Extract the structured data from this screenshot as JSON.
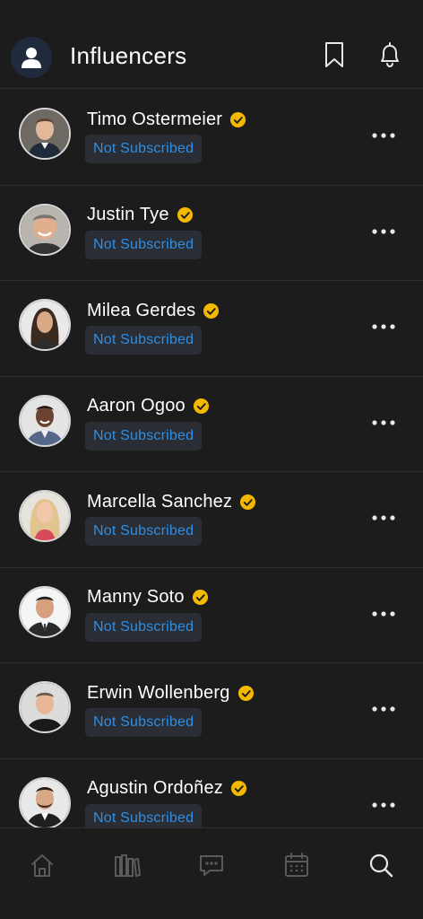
{
  "header": {
    "title": "Influencers",
    "icons": [
      "user-icon",
      "bookmark-icon",
      "bell-icon"
    ]
  },
  "influencers": [
    {
      "name": "Timo Ostermeier",
      "status": "Not Subscribed",
      "verified": true
    },
    {
      "name": "Justin Tye",
      "status": "Not Subscribed",
      "verified": true
    },
    {
      "name": "Milea Gerdes",
      "status": "Not Subscribed",
      "verified": true
    },
    {
      "name": "Aaron Ogoo",
      "status": "Not Subscribed",
      "verified": true
    },
    {
      "name": "Marcella Sanchez",
      "status": "Not Subscribed",
      "verified": true
    },
    {
      "name": "Manny Soto",
      "status": "Not Subscribed",
      "verified": true
    },
    {
      "name": "Erwin Wollenberg",
      "status": "Not Subscribed",
      "verified": true
    },
    {
      "name": "Agustin Ordoñez",
      "status": "Not Subscribed",
      "verified": true
    }
  ],
  "tabbar": {
    "tabs": [
      "home-icon",
      "library-icon",
      "chat-icon",
      "calendar-icon",
      "search-icon"
    ],
    "active": "search-icon"
  },
  "colors": {
    "background": "#1c1c1c",
    "status_text": "#2e8fe6",
    "status_bg": "#2a2d33",
    "verified": "#f3b800",
    "icon": "#e8e8e8",
    "tab_inactive": "#5a5a5a"
  }
}
